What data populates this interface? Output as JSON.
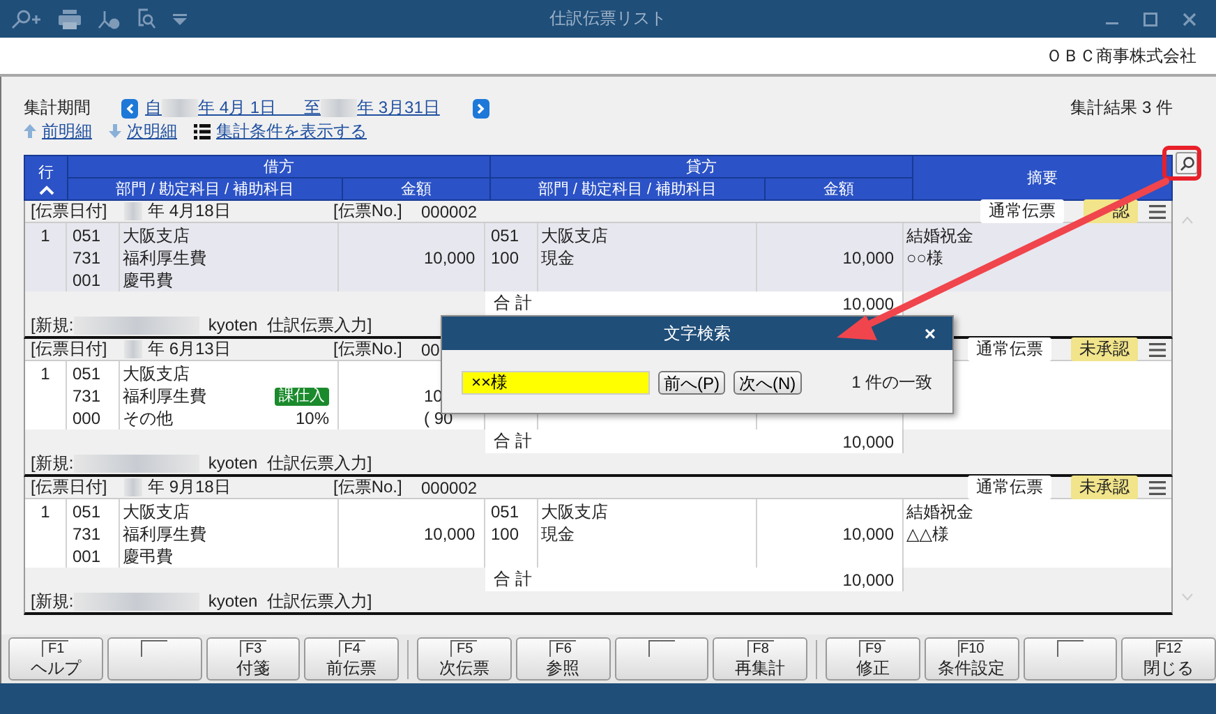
{
  "window": {
    "title": "仕訳伝票リスト"
  },
  "company": "ＯＢＣ商事株式会社",
  "period": {
    "label": "集計期間",
    "from_prefix": "自",
    "from_date": "年  4月 1日",
    "to_prefix": "至",
    "to_date": "年  3月31日"
  },
  "result_count": "集計結果 3 件",
  "nav": [
    {
      "kind": "prev",
      "label": "前明細"
    },
    {
      "kind": "next",
      "label": "次明細"
    },
    {
      "kind": "conditions",
      "label": "集計条件を表示する"
    }
  ],
  "header": {
    "row": "行",
    "debit": {
      "title": "借方",
      "account": "部門 / 勘定科目 / 補助科目",
      "amount": "金額"
    },
    "credit": {
      "title": "貸方",
      "account": "部門 / 勘定科目 / 補助科目",
      "amount": "金額"
    },
    "memo": "摘要"
  },
  "vouchers": [
    {
      "selected": true,
      "date_label": "[伝票日付]",
      "date": "年  4月18日",
      "no_label": "[伝票No.]",
      "no": "000002",
      "type": "通常伝票",
      "status": "認",
      "row": "1",
      "debit": {
        "lines": [
          {
            "code": "051",
            "name": "大阪支店"
          },
          {
            "code": "731",
            "name": "福利厚生費"
          },
          {
            "code": "001",
            "name": "慶弔費"
          }
        ],
        "amount": "10,000"
      },
      "credit": {
        "lines": [
          {
            "code": "051",
            "name": "大阪支店"
          },
          {
            "code": "100",
            "name": "現金"
          }
        ],
        "amount": "10,000"
      },
      "memo": [
        "結婚祝金",
        "○○様"
      ],
      "total_label": "合 計",
      "total": "10,000",
      "entry": {
        "prefix": "[新規:",
        "user": "kyoten",
        "source": "仕訳伝票入力]"
      }
    },
    {
      "selected": false,
      "date_label": "[伝票日付]",
      "date": "年  6月13日",
      "no_label": "[伝票No.]",
      "no": "00",
      "type": "通常伝票",
      "status": "未承認",
      "row": "1",
      "debit": {
        "lines": [
          {
            "code": "051",
            "name": "大阪支店"
          },
          {
            "code": "731",
            "name": "福利厚生費",
            "tag": "課仕入"
          },
          {
            "code": "000",
            "name": "その他",
            "rate": "10%"
          }
        ],
        "amount": "10",
        "tax": "( 90"
      },
      "total_label": "合 計",
      "total": "10,000",
      "entry": {
        "prefix": "[新規:",
        "user": "kyoten",
        "source": "仕訳伝票入力]"
      }
    },
    {
      "selected": false,
      "date_label": "[伝票日付]",
      "date": "年  9月18日",
      "no_label": "[伝票No.]",
      "no": "000002",
      "type": "通常伝票",
      "status": "未承認",
      "row": "1",
      "debit": {
        "lines": [
          {
            "code": "051",
            "name": "大阪支店"
          },
          {
            "code": "731",
            "name": "福利厚生費"
          },
          {
            "code": "001",
            "name": "慶弔費"
          }
        ],
        "amount": "10,000"
      },
      "credit": {
        "lines": [
          {
            "code": "051",
            "name": "大阪支店"
          },
          {
            "code": "100",
            "name": "現金"
          }
        ],
        "amount": "10,000"
      },
      "memo": [
        "結婚祝金",
        "△△様"
      ],
      "total_label": "合 計",
      "total": "10,000",
      "entry": {
        "prefix": "[新規:",
        "user": "kyoten",
        "source": "仕訳伝票入力]"
      }
    }
  ],
  "dialog": {
    "title": "文字検索",
    "close": "×",
    "query": "××様",
    "buttons": [
      "前へ(P)",
      "次へ(N)"
    ],
    "result": "1 件の一致"
  },
  "fkeys": [
    {
      "kind": "key",
      "key": "F1",
      "label": "ヘルプ"
    },
    {
      "kind": "blank"
    },
    {
      "kind": "key",
      "key": "F3",
      "label": "付箋"
    },
    {
      "kind": "key",
      "key": "F4",
      "label": "前伝票"
    },
    {
      "kind": "key",
      "key": "F5",
      "label": "次伝票"
    },
    {
      "kind": "key",
      "key": "F6",
      "label": "参照"
    },
    {
      "kind": "blank"
    },
    {
      "kind": "key",
      "key": "F8",
      "label": "再集計"
    },
    {
      "kind": "key",
      "key": "F9",
      "label": "修正"
    },
    {
      "kind": "key",
      "key": "F10",
      "label": "条件設定"
    },
    {
      "kind": "blank"
    },
    {
      "kind": "key",
      "key": "F12",
      "label": "閉じる"
    }
  ]
}
